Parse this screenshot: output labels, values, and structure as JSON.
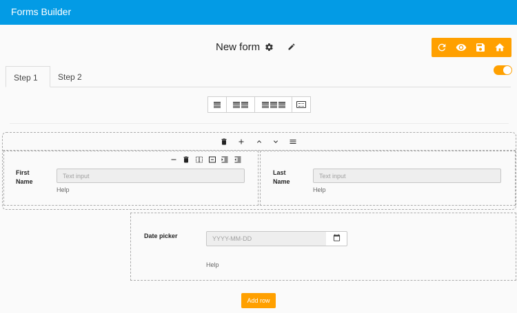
{
  "app": {
    "title": "Forms Builder"
  },
  "form": {
    "title": "New form",
    "icons": {
      "settings": "gear-icon",
      "edit": "pencil-icon"
    }
  },
  "actions": {
    "icons": [
      "refresh-icon",
      "eye-icon",
      "save-icon",
      "home-icon"
    ]
  },
  "toggle": {
    "state": "on"
  },
  "tabs": [
    {
      "label": "Step 1",
      "active": true
    },
    {
      "label": "Step 2",
      "active": false
    }
  ],
  "layout_toolbar": {
    "buttons": [
      "one-column",
      "two-columns",
      "three-columns",
      "keyboard"
    ]
  },
  "row_toolbar": {
    "icons": [
      "delete-icon",
      "add-icon",
      "chevron-up-icon",
      "chevron-down-icon",
      "menu-icon"
    ]
  },
  "column_toolbar": {
    "icons": [
      "minus-icon",
      "delete-icon",
      "split-icon",
      "merge-icon",
      "indent-increase-icon",
      "indent-decrease-icon"
    ]
  },
  "fields": {
    "first_name": {
      "label": "First Name",
      "placeholder": "Text input",
      "help": "Help"
    },
    "last_name": {
      "label": "Last Name",
      "placeholder": "Text input",
      "help": "Help"
    },
    "date_picker": {
      "label": "Date picker",
      "placeholder": "YYYY-MM-DD",
      "help": "Help"
    }
  },
  "add_row": {
    "label": "Add row"
  },
  "colors": {
    "appbar": "#039be5",
    "accent": "#ffa000"
  }
}
